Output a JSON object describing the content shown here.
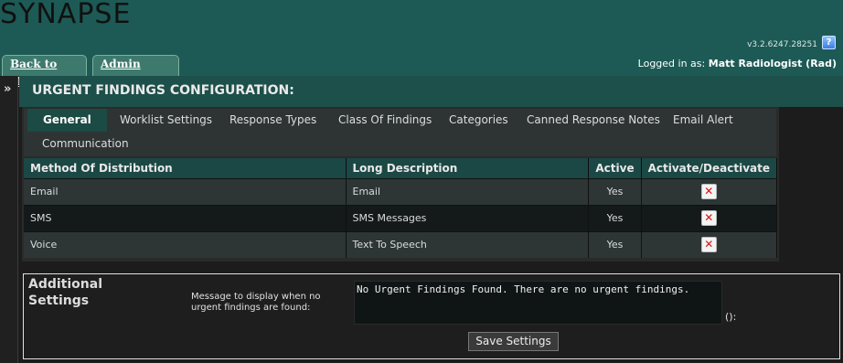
{
  "header": {
    "logo_text": "SYNAPSE",
    "logo_mark": "®",
    "version": "v3.2.6247.28251"
  },
  "top_tabs": {
    "back": "Back to Main",
    "admin": "Admin Home"
  },
  "session": {
    "prefix": "Logged in as:",
    "user": "Matt Radiologist (Rad)"
  },
  "sidebar": {
    "expand_glyph": "»"
  },
  "page_title": "URGENT FINDINGS CONFIGURATION:",
  "sub_tabs": [
    {
      "label": "General",
      "active": true
    },
    {
      "label": "Worklist Settings"
    },
    {
      "label": "Response Types"
    },
    {
      "label": "Class Of Findings"
    },
    {
      "label": "Categories"
    },
    {
      "label": "Canned Response Notes"
    },
    {
      "label": "Email Alert"
    },
    {
      "label": "Communication"
    }
  ],
  "table": {
    "headers": [
      "Method Of Distribution",
      "Long Description",
      "Active",
      "Activate/Deactivate"
    ],
    "rows": [
      {
        "method": "Email",
        "description": "Email",
        "active": "Yes"
      },
      {
        "method": "SMS",
        "description": "SMS Messages",
        "active": "Yes"
      },
      {
        "method": "Voice",
        "description": "Text To Speech",
        "active": "Yes"
      }
    ]
  },
  "additional": {
    "title": "Additional Settings",
    "label": "Message to display when no urgent findings are found:",
    "message": "No Urgent Findings Found.  There are no urgent findings.",
    "suffix": "():",
    "save_label": "Save Settings"
  },
  "colors": {
    "header_teal": "#1d5a55",
    "tab_green": "#3d7a6d",
    "title_bar": "#1d4f4b",
    "delete_red": "#dd1111"
  },
  "icons": {
    "help": "help-icon",
    "expand": "expand-icon",
    "delete": "delete-icon"
  }
}
